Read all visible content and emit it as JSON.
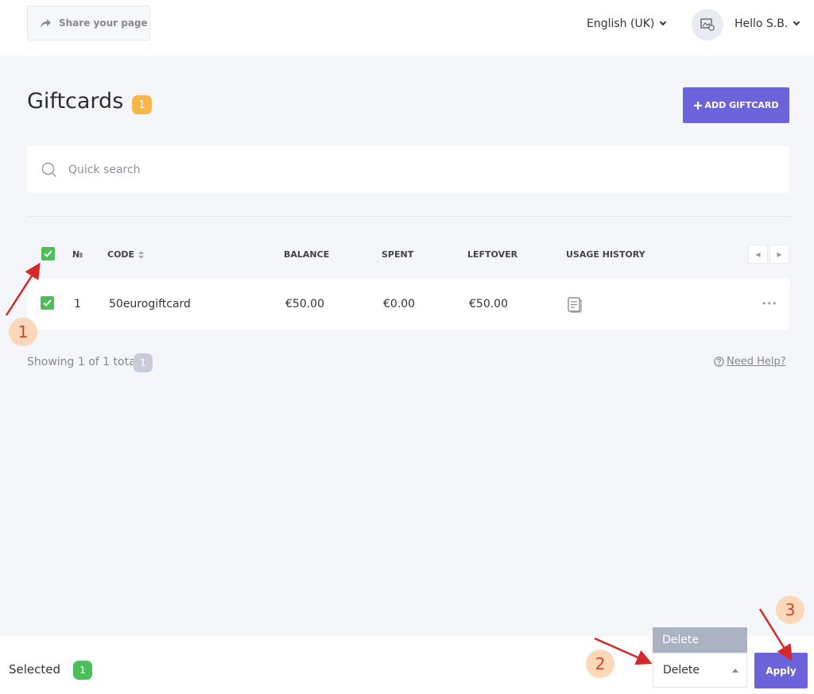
{
  "header": {
    "share_label": "Share your page",
    "language": "English (UK)",
    "greeting": "Hello S.B."
  },
  "page": {
    "title": "Giftcards",
    "count_badge": "1",
    "add_button": "ADD GIFTCARD"
  },
  "search": {
    "placeholder": "Quick search"
  },
  "table": {
    "columns": [
      "№",
      "CODE",
      "BALANCE",
      "SPENT",
      "LEFTOVER",
      "USAGE HISTORY"
    ],
    "rows": [
      {
        "number": "1",
        "code": "50eurogiftcard",
        "balance": "€50.00",
        "spent": "€0.00",
        "leftover": "€50.00",
        "more": "•••"
      }
    ]
  },
  "footer": {
    "showing": "Showing 1 of 1 total",
    "total_badge": "1",
    "help": "Need Help?"
  },
  "bulk": {
    "selected_label": "Selected",
    "selected_count": "1",
    "menu_option": "Delete",
    "select_value": "Delete",
    "apply": "Apply"
  },
  "annotations": {
    "steps": [
      "1",
      "2",
      "3"
    ],
    "arrow_color": "#d62828"
  },
  "colors": {
    "accent": "#6b63d9",
    "check": "#4cbf5a",
    "badge": "#f7b64a"
  }
}
